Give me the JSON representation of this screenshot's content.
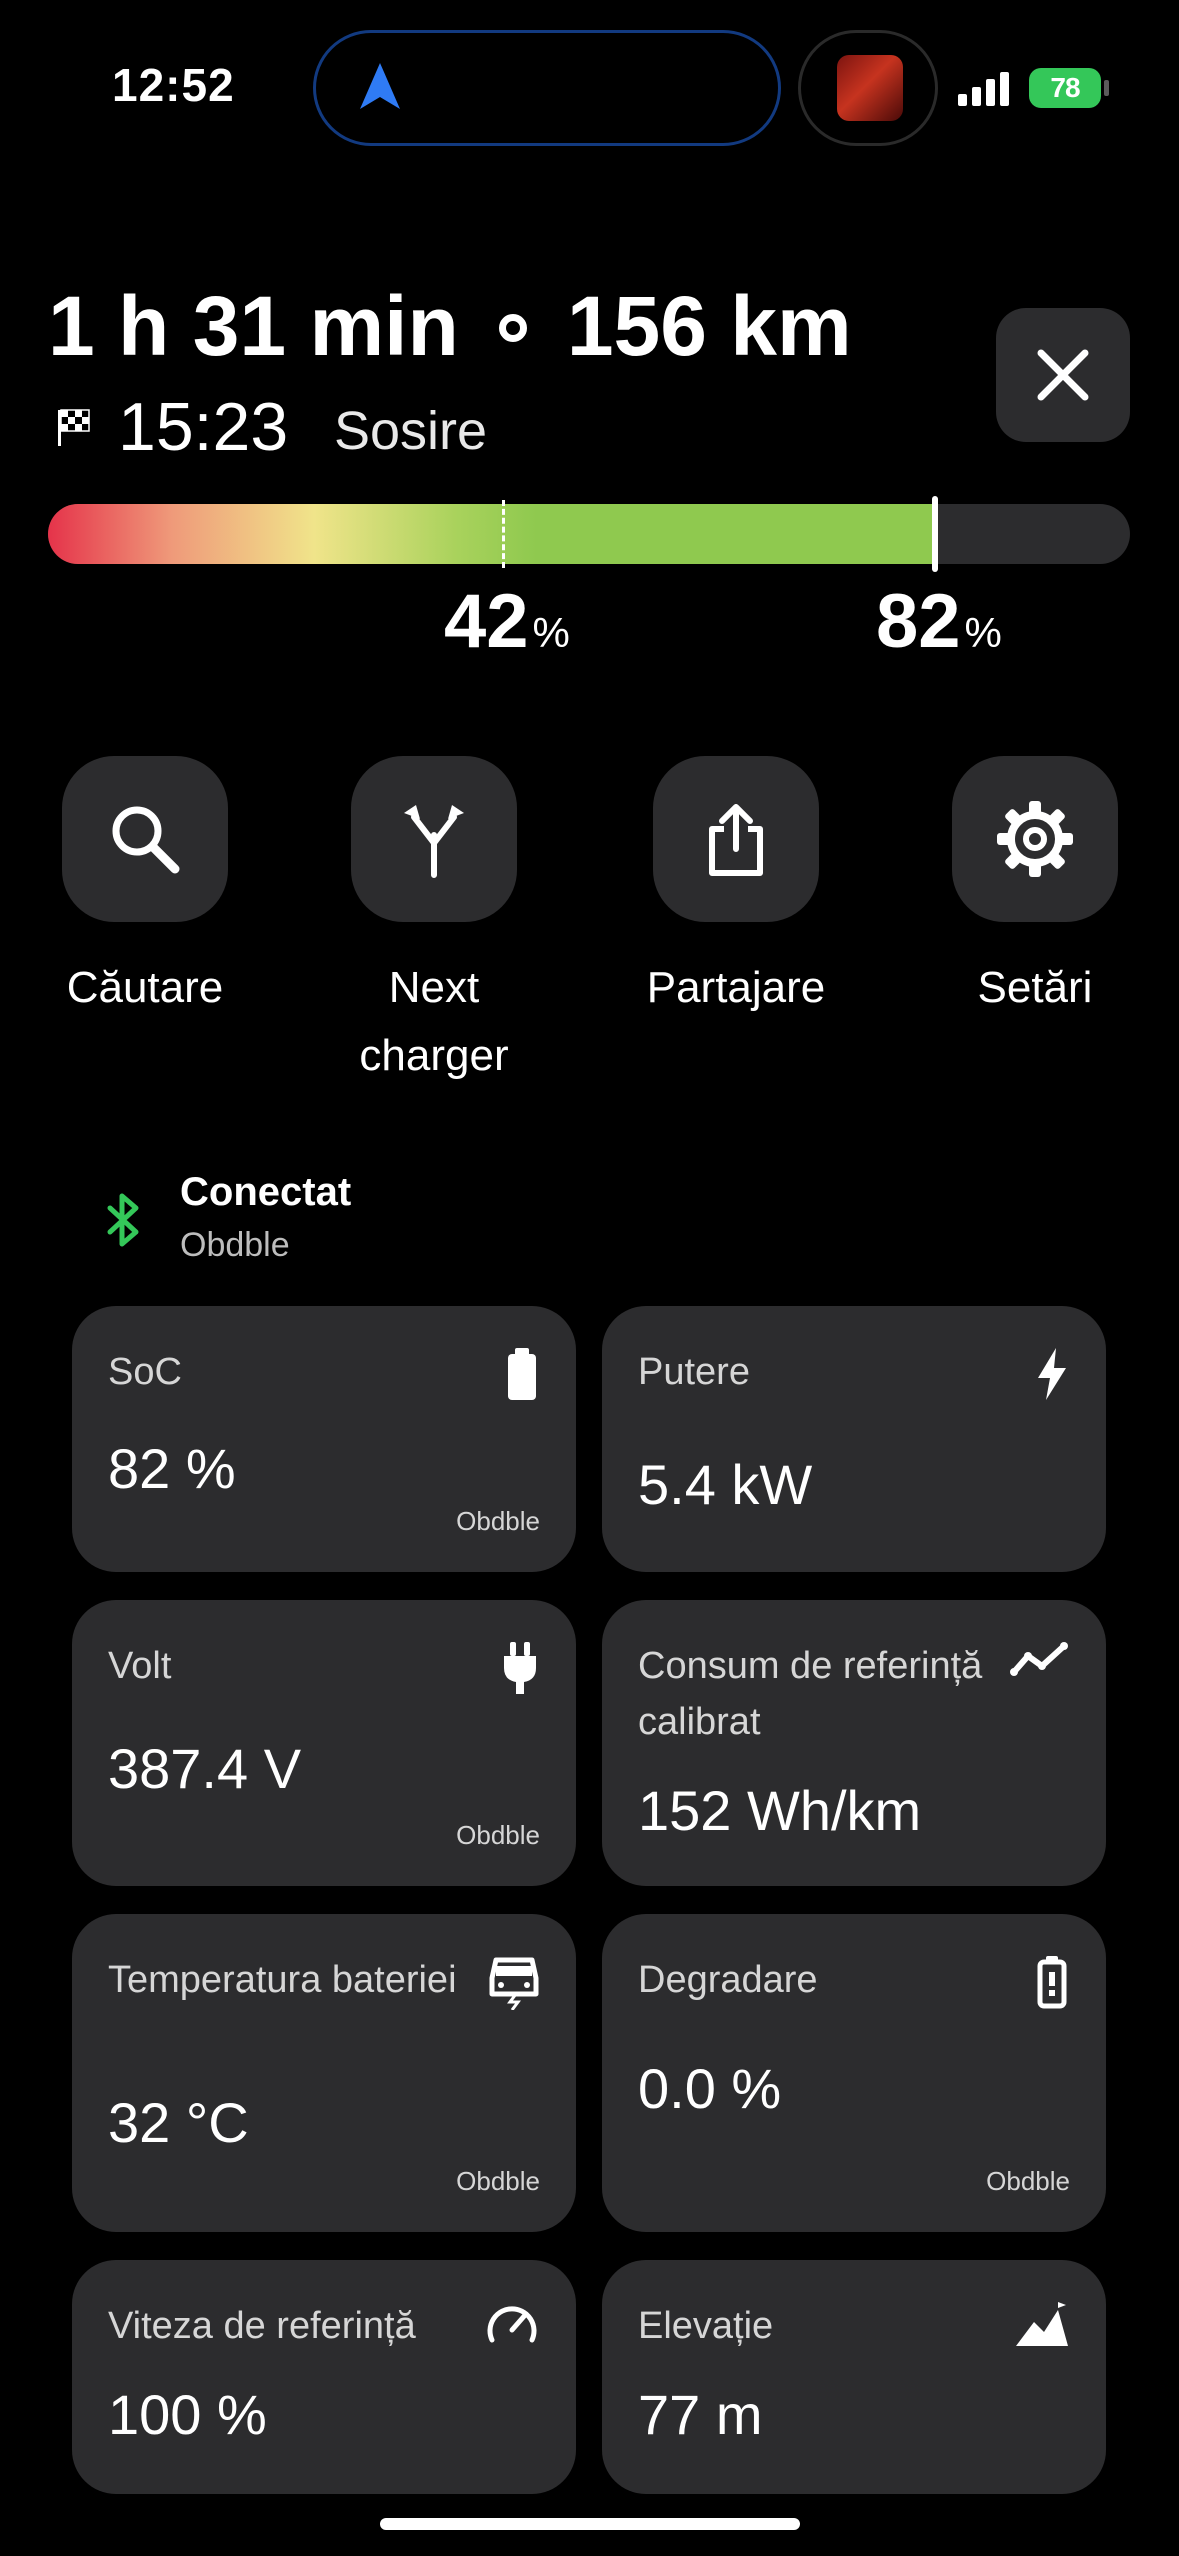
{
  "status_bar": {
    "time": "12:52",
    "battery": "78"
  },
  "trip": {
    "duration": "1 h 31 min",
    "distance": "156 km",
    "arrival_time": "15:23",
    "arrival_label": "Sosire",
    "start_soc": "42",
    "end_soc": "82",
    "percent_unit": "%",
    "charge_fill_fraction": 0.82,
    "current_marker_fraction": 0.42
  },
  "actions": [
    {
      "label": "Căutare",
      "icon": "search-icon"
    },
    {
      "label": "Next charger",
      "icon": "route-split-icon"
    },
    {
      "label": "Partajare",
      "icon": "share-icon"
    },
    {
      "label": "Setări",
      "icon": "gear-icon"
    }
  ],
  "connection": {
    "status": "Conectat",
    "device": "Obdble"
  },
  "cards": [
    {
      "title": "SoC",
      "value": "82 %",
      "source": "Obdble",
      "icon": "battery-icon"
    },
    {
      "title": "Putere",
      "value": "5.4 kW",
      "source": "",
      "icon": "lightning-icon"
    },
    {
      "title": "Volt",
      "value": "387.4 V",
      "source": "Obdble",
      "icon": "plug-icon"
    },
    {
      "title": "Consum de referință calibrat",
      "value": "152 Wh/km",
      "source": "",
      "icon": "trend-icon"
    },
    {
      "title": "Temperatura bateriei",
      "value": "32 °C",
      "source": "Obdble",
      "icon": "car-battery-icon"
    },
    {
      "title": "Degradare",
      "value": "0.0 %",
      "source": "Obdble",
      "icon": "battery-health-icon"
    },
    {
      "title": "Viteza de referință",
      "value": "100 %",
      "source": "",
      "icon": "speedometer-icon"
    },
    {
      "title": "Elevație",
      "value": "77 m",
      "source": "",
      "icon": "elevation-icon"
    }
  ],
  "colors": {
    "accent_green": "#8fc94f",
    "bluetooth_green": "#34c759",
    "card_bg": "#2c2c2e",
    "nav_blue": "#2f7bf5"
  }
}
